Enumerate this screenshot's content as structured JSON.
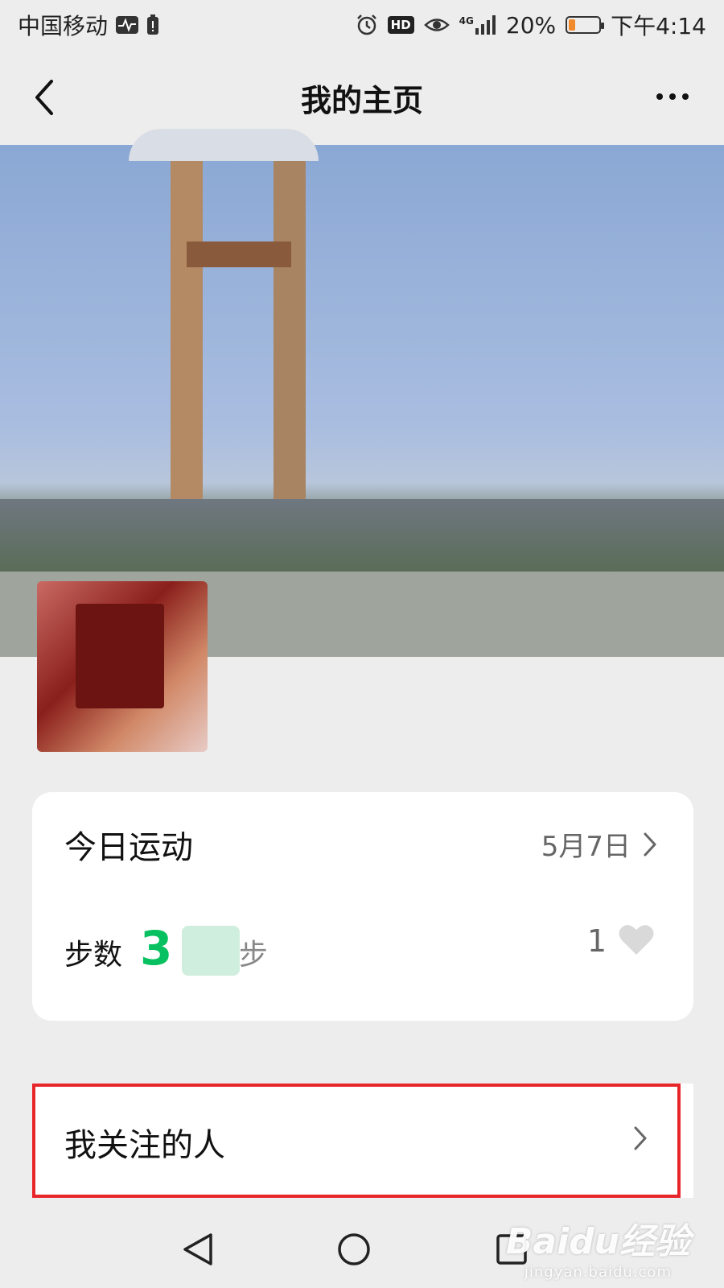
{
  "status_bar": {
    "carrier": "中国移动",
    "network": "4G",
    "battery_percent": "20%",
    "time": "下午4:14",
    "hd_label": "HD",
    "battery_level": 0.2,
    "battery_color": "#f08a2c"
  },
  "nav": {
    "title": "我的主页"
  },
  "sport_card": {
    "title": "今日运动",
    "date": "5月7日",
    "steps_label": "步数",
    "steps_value": "3  5",
    "steps_unit": "步",
    "likes_count": "1",
    "steps_color": "#07c160"
  },
  "follow_row": {
    "label": "我关注的人",
    "highlight_color": "#e8262a"
  },
  "watermark": {
    "main": "Baidu经验",
    "sub": "jingyan.baidu.com"
  },
  "icons": {
    "back": "back-arrow-icon",
    "more": "more-dots-icon",
    "chevron": "chevron-right-icon",
    "heart": "heart-icon",
    "nav_back": "triangle-back-icon",
    "home": "circle-home-icon",
    "recents": "square-recents-icon"
  }
}
